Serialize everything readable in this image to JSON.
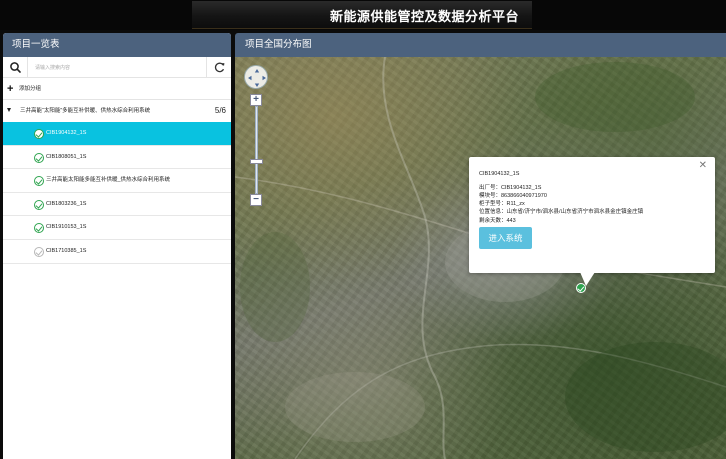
{
  "app": {
    "title": "新能源供能管控及数据分析平台"
  },
  "left_panel": {
    "title": "项目一览表",
    "search": {
      "placeholder": "请输入搜索内容",
      "value": ""
    },
    "add_group_label": "添加分组",
    "group": {
      "label": "三井高能“太阳能”多能互补供暖、供热水综合利用系统",
      "count": "5/6"
    },
    "items": [
      {
        "label": "CIB1904132_1S",
        "status": "active"
      },
      {
        "label": "CIB1808051_1S",
        "status": "online"
      },
      {
        "label": "三井高能太阳能多能互补供暖_供热水综合利用系统",
        "status": "online"
      },
      {
        "label": "CIB1803236_1S",
        "status": "online"
      },
      {
        "label": "CIB1910153_1S",
        "status": "online"
      },
      {
        "label": "CIB1710385_1S",
        "status": "offline"
      }
    ]
  },
  "map_panel": {
    "title": "项目全国分布图",
    "zoom_in": "+",
    "zoom_out": "−",
    "popup": {
      "title": "CIB1904132_1S",
      "lines": [
        "出厂号：CIB1904132_1S",
        "模块号：863866040971970",
        "柜子型号：R11_zx",
        "位置信息：山东省/济宁市/泗水县/山东省济宁市泗水县金庄镇金庄镇",
        "剩余天数：443"
      ],
      "button_label": "进入系统",
      "close_label": "✕"
    }
  },
  "colors": {
    "header": "#4c627e",
    "active_row": "#09c2e0",
    "online_icon": "#2ea44f",
    "offline_icon": "#b7b7b7",
    "enter_button": "#5bc0de"
  },
  "icons": {
    "search": "search-icon",
    "refresh": "refresh-icon",
    "add": "plus-icon",
    "group_toggle": "caret-down-icon",
    "item_status": "check-circle-icon",
    "map_nav": "pan-arrows-icon",
    "close": "close-icon",
    "marker": "map-marker-icon"
  }
}
